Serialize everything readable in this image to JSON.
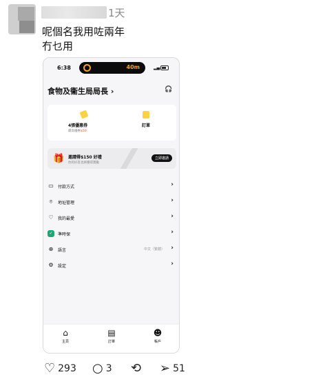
{
  "post": {
    "time": "1天",
    "text_line1": "呢個名我用咗兩年",
    "text_line2": "冇乜用"
  },
  "phone": {
    "status": {
      "time": "6:38",
      "activity_minutes": "40m"
    },
    "title": "食物及衞生局局長 ›",
    "summary": {
      "coupon_label": "4張優惠券",
      "coupon_sub_prefix": "最高優惠",
      "coupon_sub_amount": "$50",
      "order_label": "訂單"
    },
    "invite": {
      "title": "邀請得$150 好禮",
      "subtitle": "你的好友也將獲得獎勵",
      "button": "立即邀請"
    },
    "menu": [
      {
        "label": "付款方式",
        "icon": "card-icon",
        "value": ""
      },
      {
        "label": "地址管理",
        "icon": "location-pin-icon",
        "value": ""
      },
      {
        "label": "我的最愛",
        "icon": "heart-icon",
        "value": ""
      },
      {
        "label": "準時保",
        "icon": "shield-icon",
        "value": ""
      },
      {
        "label": "語言",
        "icon": "globe-icon",
        "value": "中文（繁體）"
      },
      {
        "label": "設定",
        "icon": "gear-icon",
        "value": ""
      }
    ],
    "tabs": [
      {
        "label": "主頁",
        "icon": "home-icon"
      },
      {
        "label": "訂單",
        "icon": "receipt-icon"
      },
      {
        "label": "帳戶",
        "icon": "account-icon"
      }
    ]
  },
  "actions": {
    "likes": "293",
    "comments": "3",
    "shares": "51"
  },
  "colors": {
    "accent": "#ffd23f",
    "shield": "#1ea672",
    "promo": "#e8541e"
  }
}
